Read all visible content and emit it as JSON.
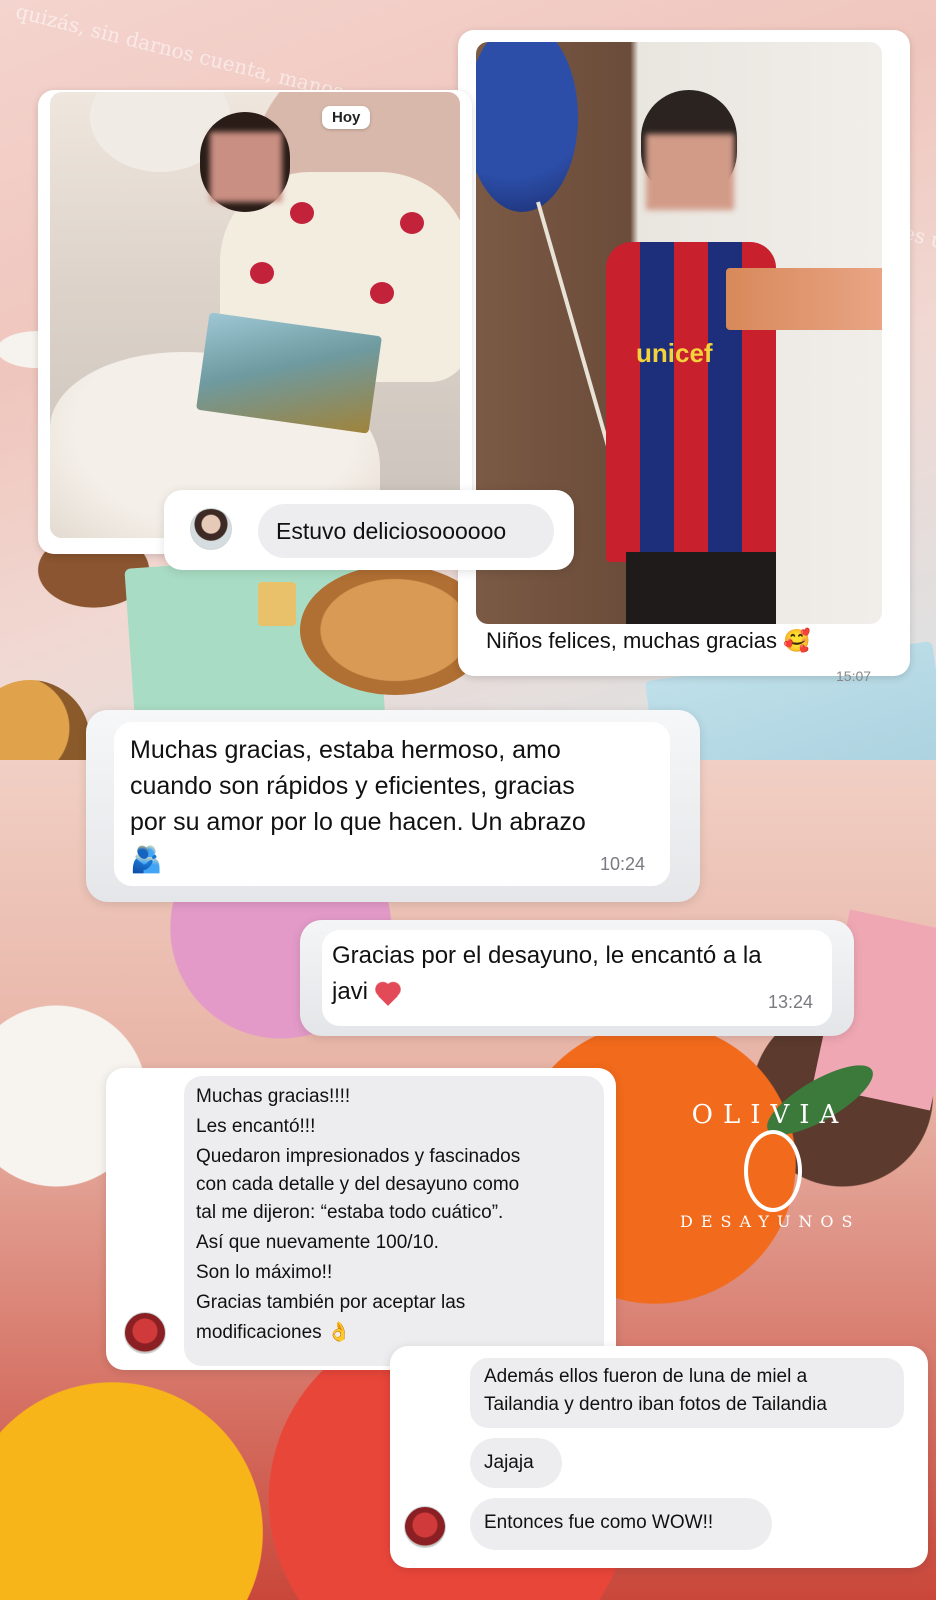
{
  "background": {
    "script_text": "quizás, sin darnos cuenta, manos pacientes... para correr, sino para disfrutar. Este regalo es un..."
  },
  "photo_left": {
    "badge": "Hoy"
  },
  "chat_left_photo": {
    "message": "Estuvo deliciosoooooo"
  },
  "photo_right": {
    "shirt_text": "unicef",
    "caption": "Niños felices, muchas gracias 🥰",
    "time_cut": "15:07"
  },
  "chat_1": {
    "lines": [
      "Muchas gracias, estaba hermoso, amo",
      "cuando son rápidos y eficientes, gracias",
      "por su amor por lo que hacen. Un abrazo"
    ],
    "emoji": "🫂",
    "time": "10:24"
  },
  "chat_2": {
    "lines": [
      "Gracias por el desayuno, le encantó a la",
      "javi"
    ],
    "time": "13:24"
  },
  "chat_3": {
    "lines": [
      "Muchas gracias!!!!",
      "Les encantó!!!",
      "Quedaron impresionados y fascinados",
      "con cada detalle y del desayuno como",
      "tal me dijeron: “estaba todo cuático”.",
      "Así que nuevamente  100/10.",
      "Son lo máximo!!",
      "Gracias también por aceptar las",
      "modificaciones 👌"
    ]
  },
  "chat_4": {
    "msg1_lines": [
      "Además ellos fueron de luna de miel a",
      "Tailandia y dentro iban fotos de Tailandia"
    ],
    "msg2": "Jajaja",
    "msg3": "Entonces fue como WOW!!"
  },
  "logo": {
    "top_text": "OLIVIA",
    "bottom_text": "DESAYUNOS",
    "monogram": "O"
  }
}
